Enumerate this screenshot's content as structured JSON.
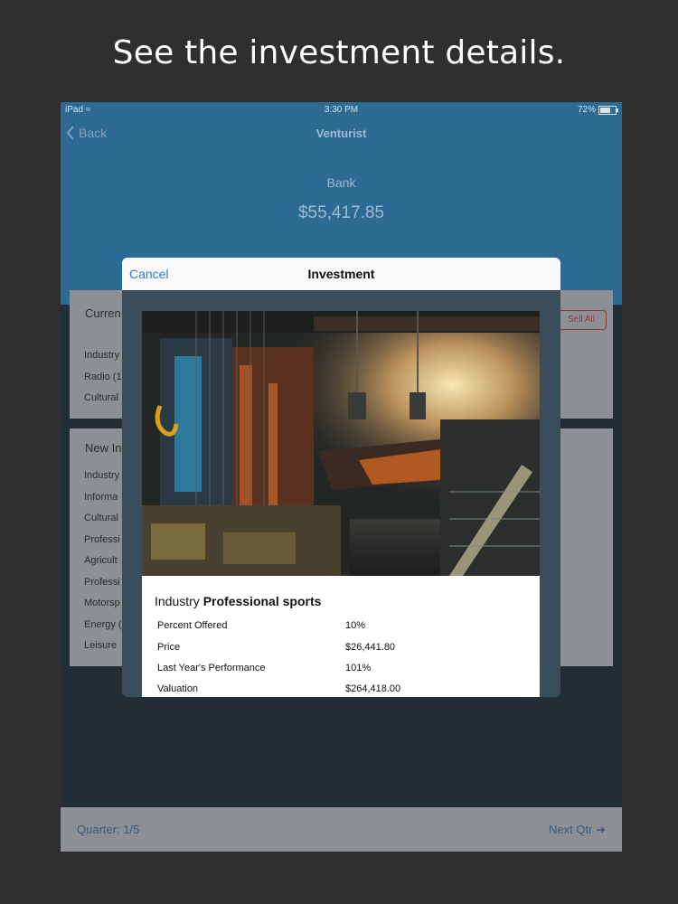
{
  "caption": "See the investment details.",
  "status_bar": {
    "device": "iPad",
    "time": "3:30 PM",
    "battery": "72%"
  },
  "nav": {
    "back_label": "Back",
    "title": "Venturist"
  },
  "bank": {
    "label": "Bank",
    "value": "$55,417.85"
  },
  "current_card": {
    "title": "Curren",
    "sell_all": "Sell All",
    "rows": [
      "Industry",
      "Radio (1",
      "Cultural"
    ]
  },
  "new_card": {
    "title": "New Inv",
    "rows": [
      "Industry",
      "Informa",
      "Cultural",
      "Professi",
      "Agricult",
      "Professi",
      "Motorsp",
      "Energy (",
      "Leisure"
    ]
  },
  "bottom_bar": {
    "quarter": "Quarter: 1/5",
    "next_label": "Next Qtr"
  },
  "modal": {
    "cancel_label": "Cancel",
    "title": "Investment",
    "industry_prefix": "Industry",
    "industry_name": "Professional sports",
    "details": [
      {
        "label": "Percent Offered",
        "value": "10%"
      },
      {
        "label": "Price",
        "value": "$26,441.80"
      },
      {
        "label": "Last Year's Performance",
        "value": "101%"
      },
      {
        "label": "Valuation",
        "value": "$264,418.00"
      }
    ]
  },
  "colors": {
    "header_blue": "#2d6a94",
    "cancel_blue": "#3478c6",
    "sell_red": "#8b3b3b"
  }
}
